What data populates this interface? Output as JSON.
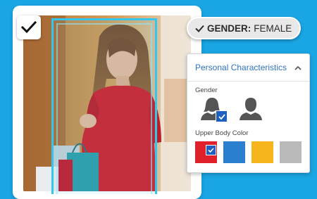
{
  "gender_tag": {
    "key": "GENDER:",
    "value": "FEMALE"
  },
  "panel": {
    "title": "Personal Characteristics",
    "gender_label": "Gender",
    "gender_options": [
      {
        "icon": "female-avatar-icon",
        "selected": true
      },
      {
        "icon": "male-avatar-icon",
        "selected": false
      }
    ],
    "upper_body_color_label": "Upper Body Color",
    "color_options": [
      {
        "color": "#e0212b",
        "selected": true
      },
      {
        "color": "#2a7fcf",
        "selected": false
      },
      {
        "color": "#f6b51d",
        "selected": false
      },
      {
        "color": "#b9b9b9",
        "selected": false
      }
    ]
  },
  "colors": {
    "background": "#1aa6e4",
    "accent_blue": "#2f73c2",
    "detection_box": "#33c7ef",
    "check_fill": "#1f5fbf"
  }
}
